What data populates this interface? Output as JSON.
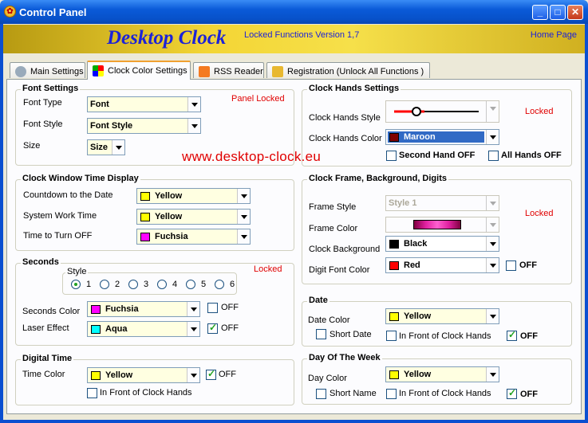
{
  "window": {
    "title": "Control Panel"
  },
  "banner": {
    "brand": "Desktop Clock",
    "version": "Locked Functions Version 1,7",
    "home": "Home Page"
  },
  "tabs": [
    {
      "label": "Main Settings"
    },
    {
      "label": "Clock Color Settings"
    },
    {
      "label": "RSS Reader"
    },
    {
      "label": "Registration  (Unlock All Functions )"
    }
  ],
  "website": "www.desktop-clock.eu",
  "font_settings": {
    "title": "Font Settings",
    "locked": "Panel Locked",
    "font_type_label": "Font Type",
    "font_type_value": "Font",
    "font_style_label": "Font Style",
    "font_style_value": "Font Style",
    "size_label": "Size",
    "size_value": "Size"
  },
  "clock_window": {
    "title": "Clock Window Time Display",
    "countdown_label": "Countdown to the Date",
    "countdown_value": "Yellow",
    "countdown_color": "#ffff00",
    "system_label": "System Work Time",
    "system_value": "Yellow",
    "system_color": "#ffff00",
    "turnoff_label": "Time to Turn OFF",
    "turnoff_value": "Fuchsia",
    "turnoff_color": "#ff00ff"
  },
  "seconds": {
    "title": "Seconds",
    "locked": "Locked",
    "style_label": "Style",
    "styles": [
      "1",
      "2",
      "3",
      "4",
      "5",
      "6"
    ],
    "selected_style": "1",
    "color_label": "Seconds Color",
    "color_value": "Fuchsia",
    "color_swatch": "#ff00ff",
    "laser_label": "Laser Effect",
    "laser_value": "Aqua",
    "laser_swatch": "#00ffff",
    "off_label": "OFF",
    "laser_off_label": "OFF"
  },
  "digital_time": {
    "title": "Digital Time",
    "color_label": "Time Color",
    "color_value": "Yellow",
    "color_swatch": "#ffff00",
    "off_label": "OFF",
    "front_label": "In Front of Clock Hands"
  },
  "clock_hands": {
    "title": "Clock Hands Settings",
    "locked": "Locked",
    "style_label": "Clock Hands Style",
    "color_label": "Clock Hands Color",
    "color_value": "Maroon",
    "color_swatch": "#800000",
    "second_off_label": "Second Hand OFF",
    "all_off_label": "All Hands OFF"
  },
  "clock_frame": {
    "title": "Clock Frame,  Background,  Digits",
    "locked": "Locked",
    "frame_style_label": "Frame Style",
    "frame_style_value": "Style 1",
    "frame_color_label": "Frame Color",
    "frame_color_swatch": "#e020a0",
    "background_label": "Clock Background",
    "background_value": "Black",
    "background_swatch": "#000000",
    "digit_label": "Digit Font Color",
    "digit_value": "Red",
    "digit_swatch": "#ff0000",
    "off_label": "OFF"
  },
  "date": {
    "title": "Date",
    "color_label": "Date Color",
    "color_value": "Yellow",
    "color_swatch": "#ffff00",
    "short_label": "Short Date",
    "front_label": "In Front of Clock Hands",
    "off_label": "OFF"
  },
  "day_of_week": {
    "title": "Day Of The Week",
    "color_label": "Day Color",
    "color_value": "Yellow",
    "color_swatch": "#ffff00",
    "short_label": "Short Name",
    "front_label": "In Front of Clock Hands",
    "off_label": "OFF"
  }
}
